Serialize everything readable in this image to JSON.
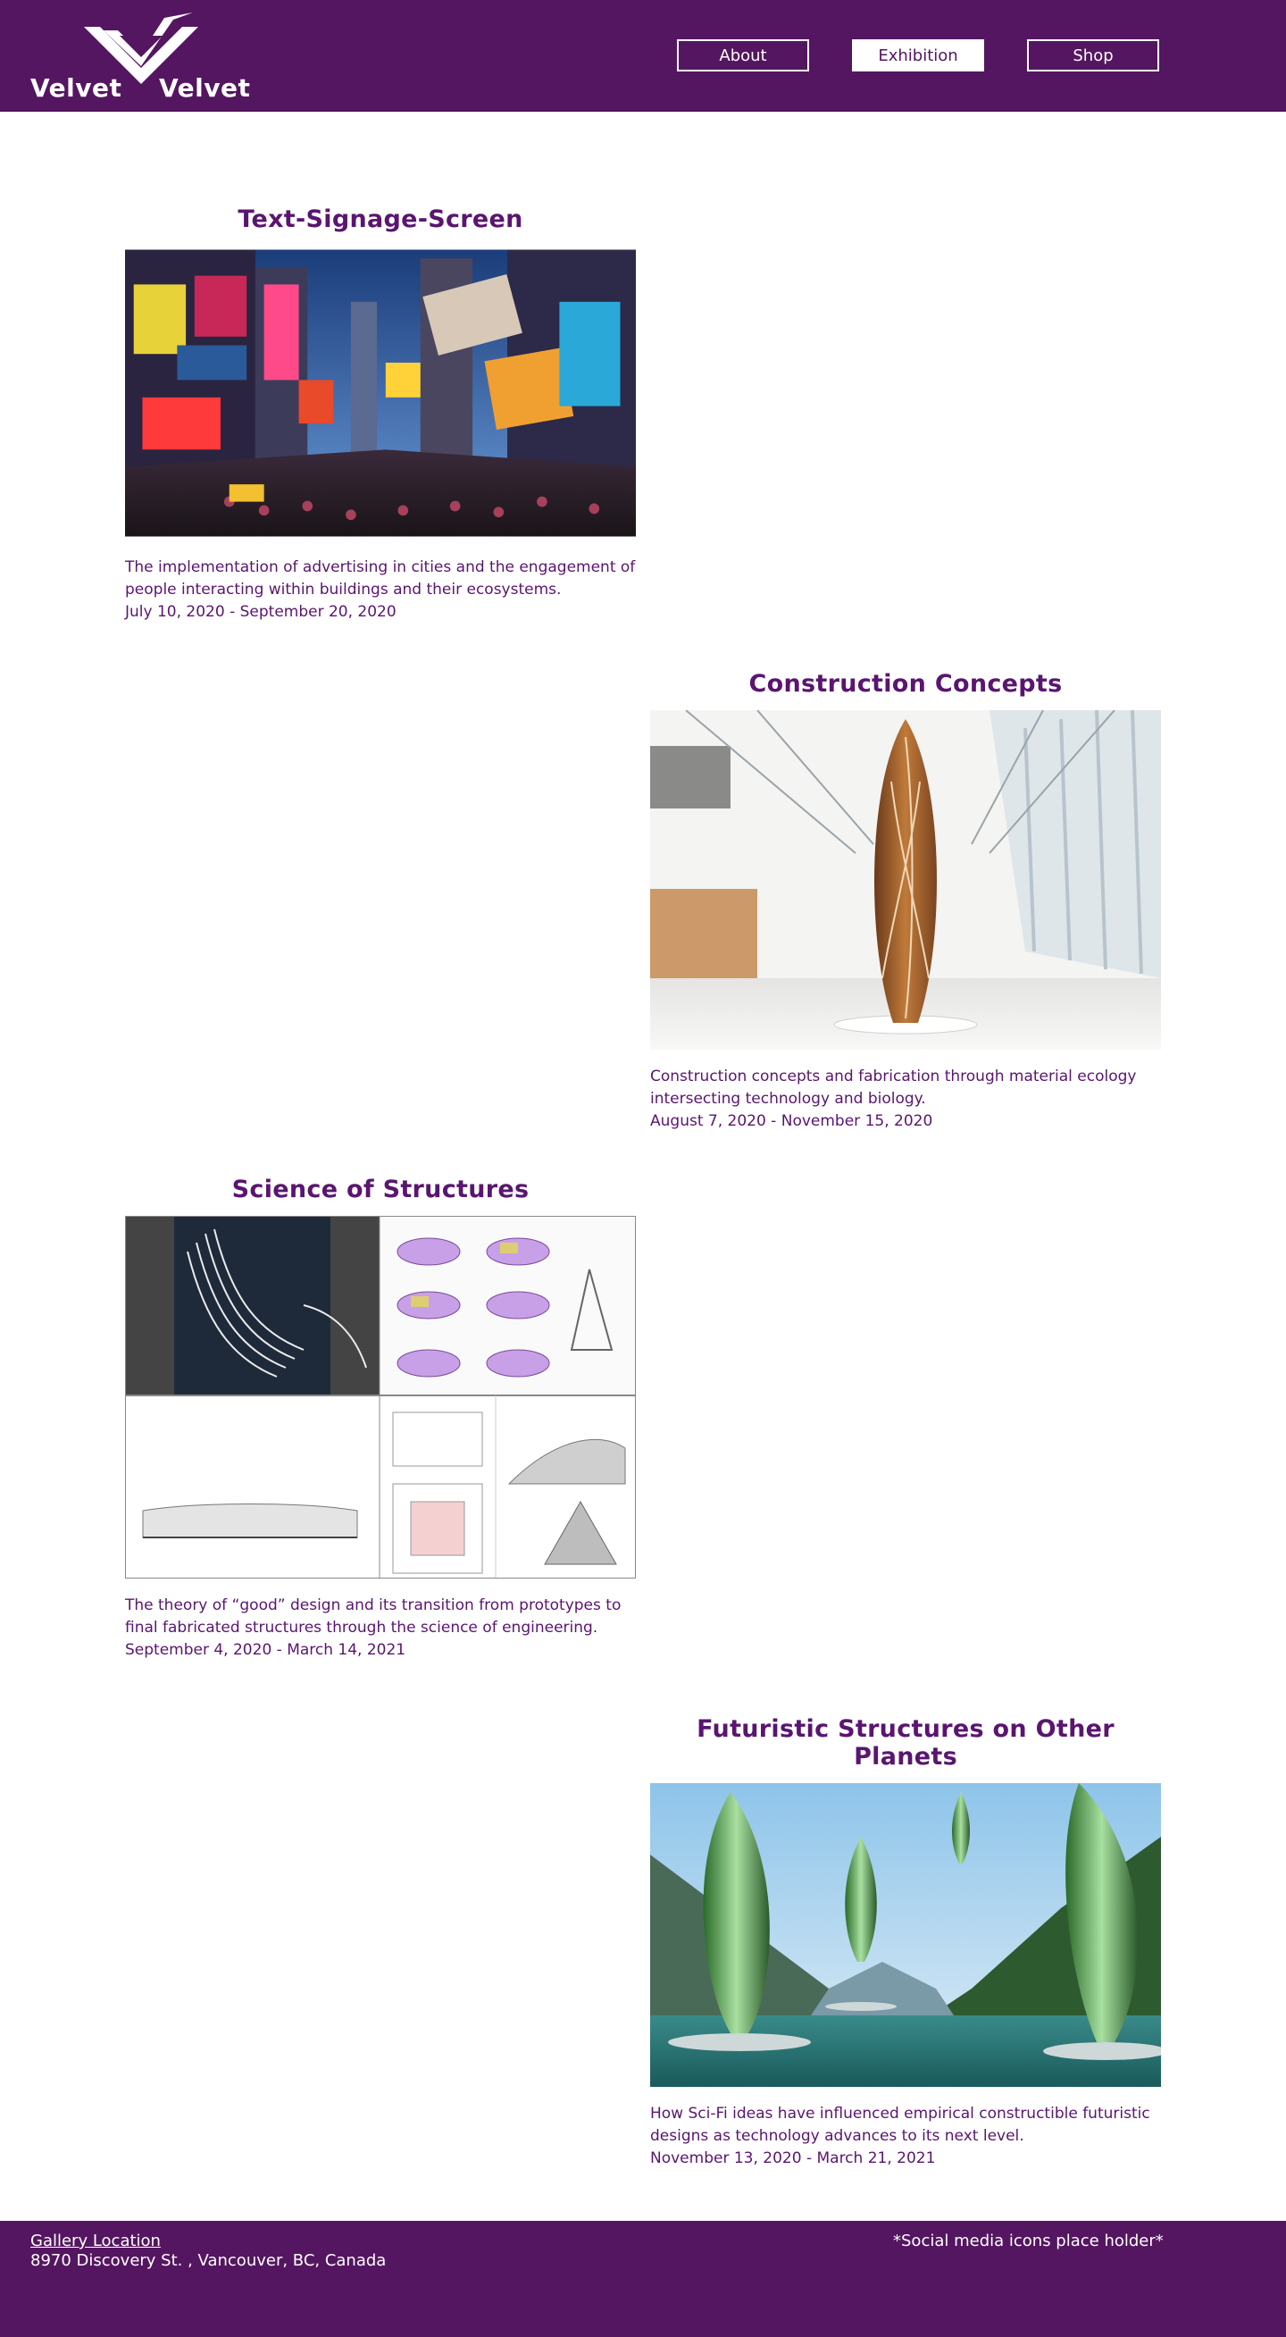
{
  "header": {
    "logo_left": "Velvet",
    "logo_right": "Velvet",
    "nav": [
      {
        "label": "About",
        "active": false
      },
      {
        "label": "Exhibition",
        "active": true
      },
      {
        "label": "Shop",
        "active": false
      }
    ]
  },
  "exhibits": [
    {
      "title": "Text-Signage-Screen",
      "description": "The implementation of advertising in cities and the engagement of people interacting within buildings and their ecosystems.",
      "dates": "July 10, 2020 - September 20, 2020",
      "image_icon": "city-signage-photo"
    },
    {
      "title": "Construction Concepts",
      "description": "Construction concepts and fabrication through material ecology intersecting technology and biology.",
      "dates": "August 7, 2020 - November 15, 2020",
      "image_icon": "sculpture-gallery-photo"
    },
    {
      "title": "Science of Structures",
      "description": "The theory of “good” design and its transition from prototypes to final fabricated structures through the science of engineering.",
      "dates": "September 4, 2020 - March 14, 2021",
      "image_icon": "architecture-sketches-image"
    },
    {
      "title": "Futuristic Structures on Other Planets",
      "description": "How Sci-Fi ideas have influenced empirical constructible futuristic designs as technology advances to its next level.",
      "dates": "November 13, 2020 - March 21, 2021",
      "image_icon": "futuristic-towers-render"
    }
  ],
  "footer": {
    "location_link": "Gallery Location",
    "address": "8970 Discovery St. , Vancouver, BC, Canada",
    "social_placeholder": "*Social media icons place holder*"
  },
  "colors": {
    "brand_purple": "#541660",
    "text_purple": "#5a1570",
    "white": "#ffffff"
  }
}
